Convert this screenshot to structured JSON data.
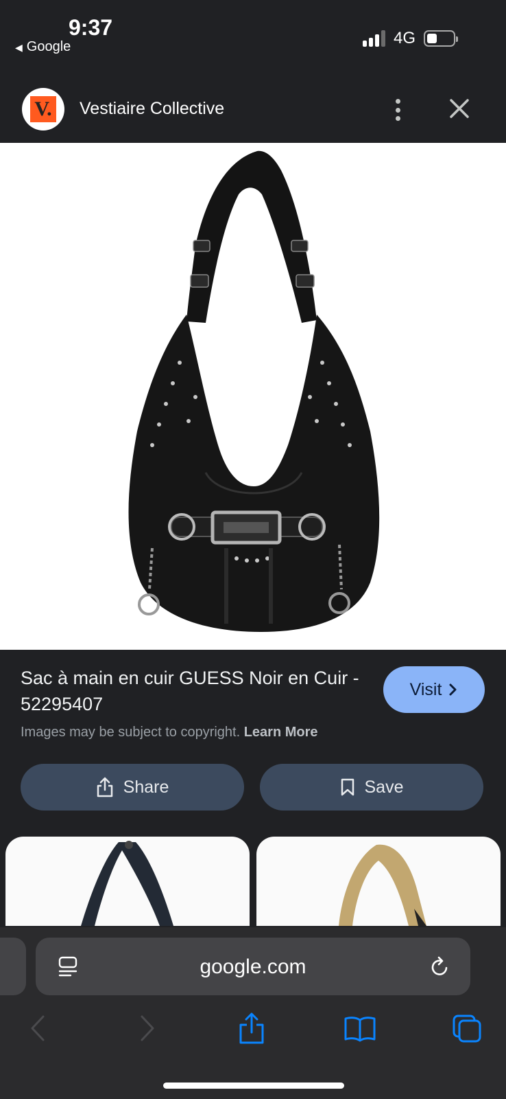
{
  "status_bar": {
    "time": "9:37",
    "back_label": "Google",
    "back_icon": "back-triangle-icon",
    "network": "4G",
    "signal_icon": "cellular-signal-icon",
    "battery_icon": "battery-icon"
  },
  "site_header": {
    "logo_letter": "V.",
    "logo_color": "#ff5a1f",
    "name": "Vestiaire Collective",
    "menu_icon": "more-vertical-icon",
    "close_icon": "close-icon"
  },
  "product": {
    "title": "Sac à main en cuir GUESS Noir en Cuir - 52295407",
    "copyright_text": "Images may be subject to copyright.",
    "learn_more": "Learn More",
    "visit_label": "Visit",
    "visit_color": "#8ab4f8"
  },
  "actions": {
    "share_label": "Share",
    "save_label": "Save",
    "button_color": "#3c4a5e"
  },
  "browser": {
    "url": "google.com",
    "reader_icon": "reader-mode-icon",
    "reload_icon": "reload-icon",
    "toolbar": [
      "back-arrow-icon",
      "forward-arrow-icon",
      "share-icon",
      "bookmarks-icon",
      "tabs-icon"
    ],
    "accent": "#0a84ff"
  }
}
